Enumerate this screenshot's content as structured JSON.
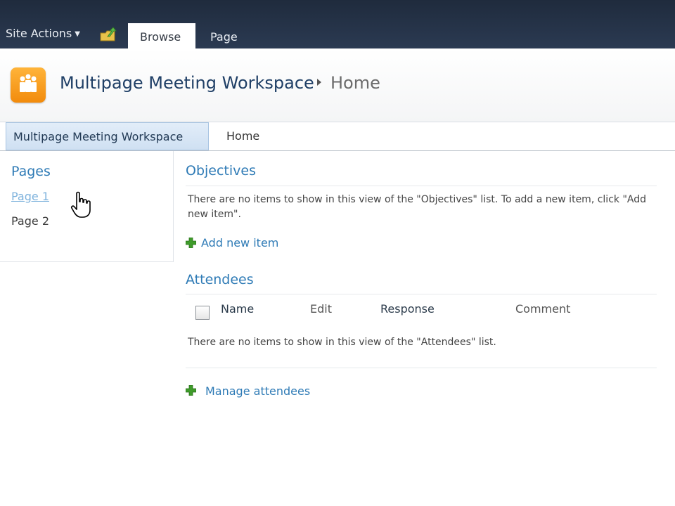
{
  "ribbon": {
    "site_actions": "Site Actions",
    "tabs": [
      {
        "label": "Browse",
        "active": true
      },
      {
        "label": "Page",
        "active": false
      }
    ]
  },
  "header": {
    "site_title": "Multipage Meeting Workspace",
    "page_name": "Home"
  },
  "topnav": {
    "items": [
      {
        "label": "Multipage Meeting Workspace",
        "active": true
      },
      {
        "label": "Home",
        "active": false
      }
    ]
  },
  "quicklaunch": {
    "heading": "Pages",
    "items": [
      {
        "label": "Page 1",
        "hovered": true
      },
      {
        "label": "Page 2",
        "hovered": false
      }
    ]
  },
  "objectives": {
    "title": "Objectives",
    "empty_text": "There are no items to show in this view of the \"Objectives\" list. To add a new item, click \"Add new item\".",
    "add_link": "Add new item"
  },
  "attendees": {
    "title": "Attendees",
    "columns": [
      "Name",
      "Edit",
      "Response",
      "Comment"
    ],
    "empty_text": "There are no items to show in this view of the \"Attendees\" list.",
    "manage_link": "Manage attendees"
  },
  "colors": {
    "ribbon_bg": "#1f2b3d",
    "link_blue": "#2f7bb6",
    "title_blue": "#1f3f66",
    "logo_orange": "#f5a01f",
    "plus_green": "#3f9b2a"
  },
  "icons": [
    "navigate-up-icon",
    "site-logo-icon",
    "breadcrumb-arrow-icon",
    "plus-icon",
    "hand-cursor-icon"
  ]
}
